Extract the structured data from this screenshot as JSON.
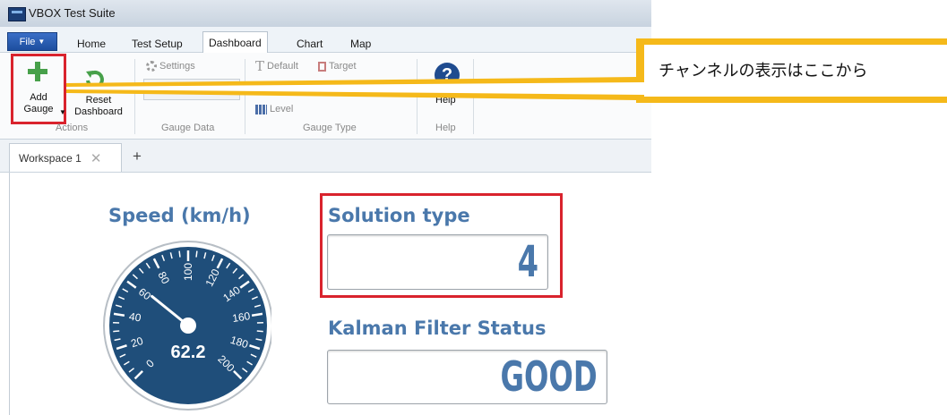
{
  "window": {
    "title": "VBOX Test Suite"
  },
  "menu": {
    "file_label": "File",
    "tabs": [
      {
        "label": "Home"
      },
      {
        "label": "Test Setup"
      },
      {
        "label": "Dashboard"
      },
      {
        "label": "Chart"
      },
      {
        "label": "Map"
      }
    ],
    "active_tab": "Dashboard"
  },
  "ribbon": {
    "actions": {
      "add_gauge": "Add\nGauge",
      "reset_dashboard": "Reset\nDashboard",
      "group_label": "Actions"
    },
    "gauge_data": {
      "settings": "Settings",
      "group_label": "Gauge Data"
    },
    "gauge_type": {
      "default": "Default",
      "target": "Target",
      "level": "Level",
      "group_label": "Gauge Type"
    },
    "help": {
      "help": "Help",
      "group_label": "Help"
    }
  },
  "workspace_tabs": [
    {
      "label": "Workspace 1"
    }
  ],
  "add_tab_label": "+",
  "gauges": {
    "speed": {
      "title": "Speed (km/h)",
      "value": 62.2,
      "value_text": "62.2",
      "min": 0,
      "max": 200,
      "ticks": [
        "0",
        "20",
        "40",
        "60",
        "80",
        "100",
        "120",
        "140",
        "160",
        "180",
        "200"
      ]
    },
    "solution_type": {
      "title": "Solution type",
      "value": "4"
    },
    "kalman": {
      "title": "Kalman Filter Status",
      "value": "GOOD"
    }
  },
  "callout": {
    "text": "チャンネルの表示はここから"
  },
  "colors": {
    "gauge_blue": "#1f4e7a",
    "title_blue": "#4a78ab",
    "highlight_red": "#d9232d",
    "callout_yellow": "#f5b91a",
    "add_green": "#47a04a"
  }
}
